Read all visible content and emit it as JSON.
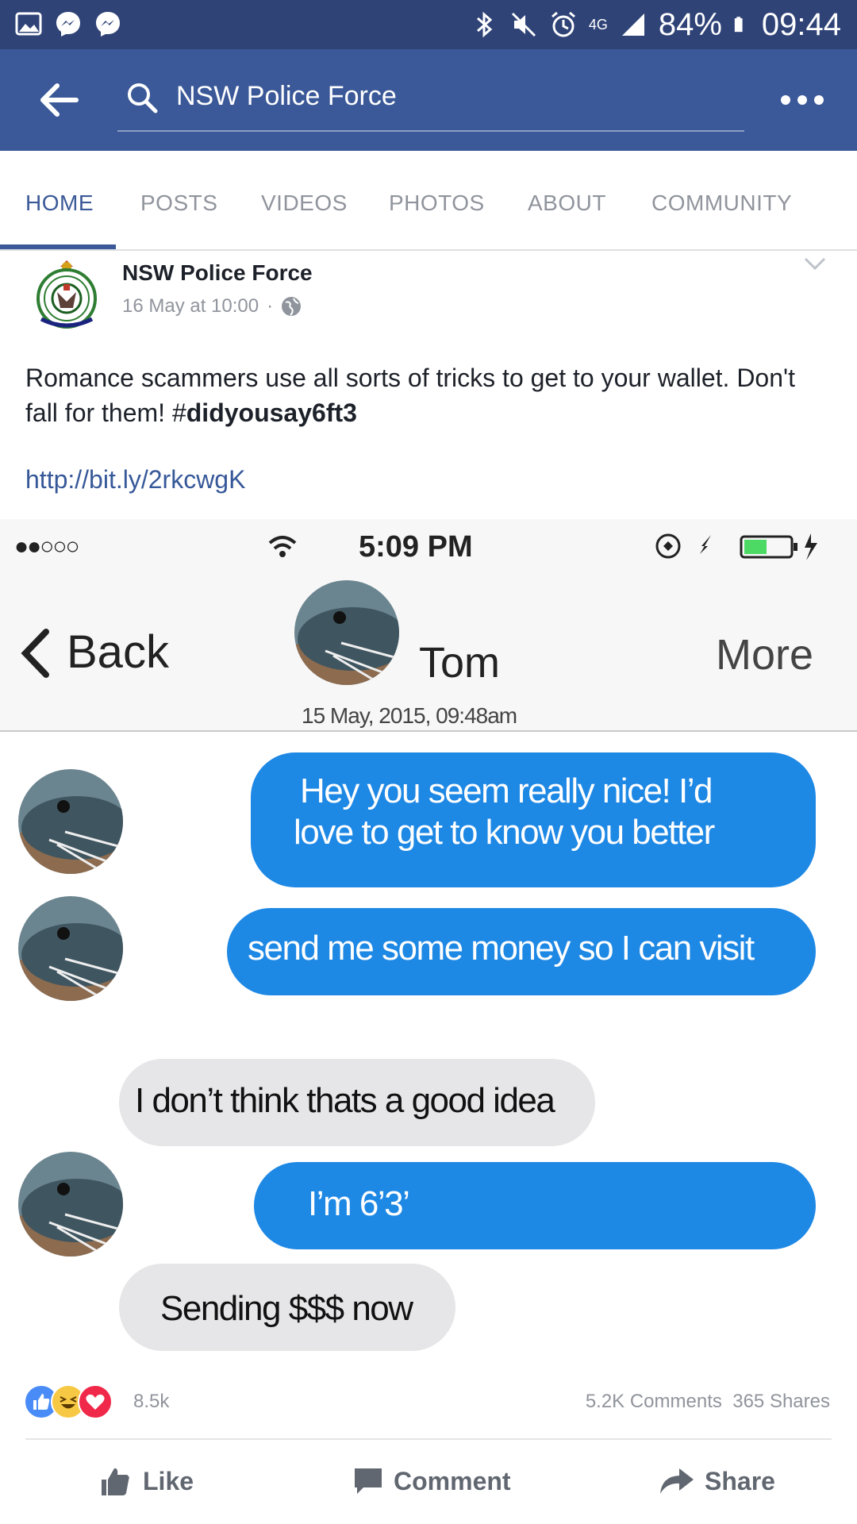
{
  "status_bar": {
    "bluetooth_icon": "bluetooth-icon",
    "network": "4G",
    "battery": "84%",
    "time": "09:44"
  },
  "app_bar": {
    "search_text": "NSW Police Force"
  },
  "tabs": [
    {
      "label": "HOME",
      "active": true
    },
    {
      "label": "POSTS"
    },
    {
      "label": "VIDEOS"
    },
    {
      "label": "PHOTOS"
    },
    {
      "label": "ABOUT"
    },
    {
      "label": "COMMUNITY"
    }
  ],
  "post": {
    "page_name": "NSW Police Force",
    "timestamp": "16 May at 10:00",
    "separator": "·",
    "text_prefix": "Romance scammers use all sorts of tricks to get to your wallet. Don't fall for them! #",
    "hashtag": "didyousay6ft3",
    "link": "http://bit.ly/2rkcwgK"
  },
  "screenshot": {
    "carrier_dots": "●●○○○",
    "time": "5:09 PM",
    "back_label": "Back",
    "contact_name": "Tom",
    "more_label": "More",
    "date": "15 May, 2015, 09:48am",
    "messages": [
      {
        "from": "them",
        "line1": "Hey you seem really nice! I’d",
        "line2": "love to get to know you better"
      },
      {
        "from": "them",
        "text": "send me some money so I can visit"
      },
      {
        "from": "me",
        "text": "I don’t think thats a good idea"
      },
      {
        "from": "them",
        "text": "I’m 6’3’"
      },
      {
        "from": "me",
        "text": "Sending $$$ now"
      }
    ]
  },
  "engagement": {
    "reactions": "8.5k",
    "comments": "5.2K Comments",
    "shares": "365 Shares"
  },
  "actions": {
    "like": "Like",
    "comment": "Comment",
    "share": "Share"
  },
  "colors": {
    "facebook_blue": "#3b5998",
    "status_bar": "#2f4377",
    "imessage_blue": "#1e88e5",
    "link": "#365899"
  }
}
